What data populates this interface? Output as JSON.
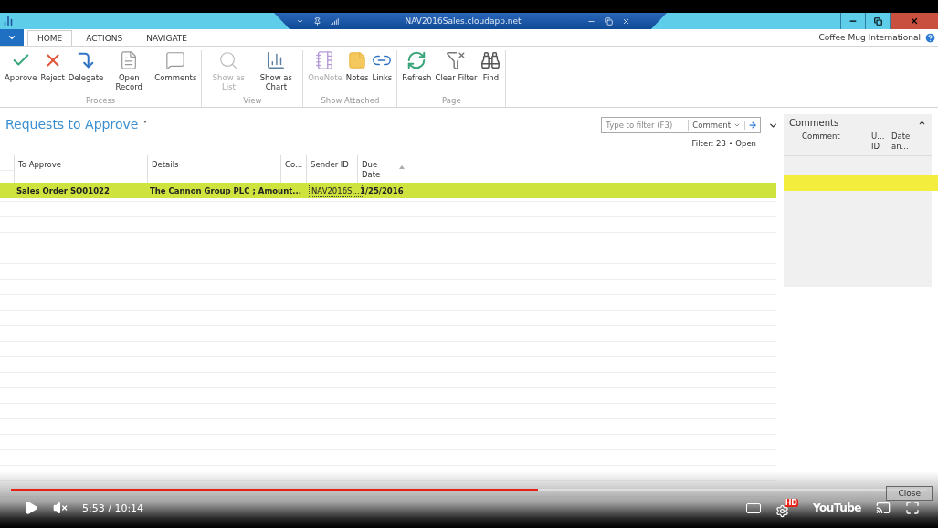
{
  "window": {
    "title": "NAV2016Sales.cloudapp.net"
  },
  "menu": {
    "tabs": [
      {
        "label": "HOME",
        "selected": true
      },
      {
        "label": "ACTIONS",
        "selected": false
      },
      {
        "label": "NAVIGATE",
        "selected": false
      }
    ],
    "company": "Coffee Mug International"
  },
  "ribbon": {
    "groups": [
      {
        "name": "Process",
        "actions": [
          {
            "kind": "approve",
            "label": "Approve",
            "disabled": false
          },
          {
            "kind": "reject",
            "label": "Reject",
            "disabled": false
          },
          {
            "kind": "delegate",
            "label": "Delegate",
            "disabled": false
          },
          {
            "kind": "record",
            "label": "Open Record",
            "disabled": false
          },
          {
            "kind": "comments",
            "label": "Comments",
            "disabled": false
          }
        ]
      },
      {
        "name": "View",
        "actions": [
          {
            "kind": "list",
            "label": "Show as List",
            "disabled": true
          },
          {
            "kind": "chart",
            "label": "Show as Chart",
            "disabled": false
          }
        ]
      },
      {
        "name": "Show Attached",
        "actions": [
          {
            "kind": "onenote",
            "label": "OneNote",
            "disabled": true
          },
          {
            "kind": "notes",
            "label": "Notes",
            "disabled": false
          },
          {
            "kind": "links",
            "label": "Links",
            "disabled": false
          }
        ]
      },
      {
        "name": "Page",
        "actions": [
          {
            "kind": "refresh",
            "label": "Refresh",
            "disabled": false
          },
          {
            "kind": "clearfilter",
            "label": "Clear Filter",
            "disabled": false
          },
          {
            "kind": "find",
            "label": "Find",
            "disabled": false
          }
        ]
      }
    ]
  },
  "page": {
    "title": "Requests to Approve",
    "filter": {
      "placeholder": "Type to filter (F3)",
      "field": "Comment"
    },
    "filter_status": "Filter: 23 • Open"
  },
  "table": {
    "columns": [
      {
        "label": "To Approve",
        "sorted": false
      },
      {
        "label": "Details",
        "sorted": false
      },
      {
        "label": "Co...",
        "sorted": false
      },
      {
        "label": "Sender ID",
        "sorted": false
      },
      {
        "label": "Due Date",
        "sorted": true
      }
    ],
    "rows": [
      {
        "selected": true,
        "cells": [
          {
            "kind": "text",
            "text": "Sales Order SO01022"
          },
          {
            "kind": "text",
            "text": "The Cannon Group PLC ; Amount..."
          },
          {
            "kind": "blank"
          },
          {
            "kind": "link",
            "text": "NAV2016S..."
          },
          {
            "kind": "text",
            "text": "1/25/2016"
          }
        ]
      }
    ]
  },
  "comments": {
    "title": "Comments",
    "columns": [
      "Comment",
      "U... ID",
      "Date an..."
    ]
  },
  "player": {
    "time": "5:53 / 10:14",
    "level": 0.575,
    "hd": "HD",
    "logo": "YouTube",
    "close": "Close"
  }
}
